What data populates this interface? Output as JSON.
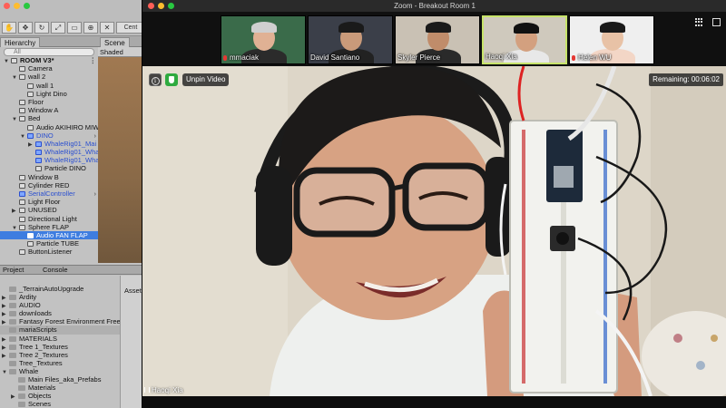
{
  "unity": {
    "toolbar": {
      "center_label": "Cent"
    },
    "tabs": {
      "hierarchy": "Hierarchy",
      "scene": "Scene"
    },
    "search_placeholder": "All",
    "scene_mode": "Shaded",
    "hierarchy": [
      {
        "label": "ROOM V3*",
        "depth": 0,
        "arrow": "▼",
        "bold": true,
        "more": "⋮"
      },
      {
        "label": "Camera",
        "depth": 1,
        "arrow": ""
      },
      {
        "label": "wall 2",
        "depth": 1,
        "arrow": "▼"
      },
      {
        "label": "wall 1",
        "depth": 2,
        "arrow": ""
      },
      {
        "label": "Light Dino",
        "depth": 2,
        "arrow": ""
      },
      {
        "label": "Floor",
        "depth": 1,
        "arrow": ""
      },
      {
        "label": "Window A",
        "depth": 1,
        "arrow": ""
      },
      {
        "label": "Bed",
        "depth": 1,
        "arrow": "▼"
      },
      {
        "label": "Audio AKIHIRO MIW",
        "depth": 2,
        "arrow": ""
      },
      {
        "label": "DINO",
        "depth": 2,
        "arrow": "▼",
        "prefab": true,
        "more": "›"
      },
      {
        "label": "WhaleRig01_Mai",
        "depth": 3,
        "arrow": "▶",
        "prefab": true
      },
      {
        "label": "WhaleRig01_Wha",
        "depth": 3,
        "arrow": "",
        "prefab": true
      },
      {
        "label": "WhaleRig01_Wha",
        "depth": 3,
        "arrow": "",
        "prefab": true
      },
      {
        "label": "Particle DINO",
        "depth": 3,
        "arrow": ""
      },
      {
        "label": "Window B",
        "depth": 1,
        "arrow": ""
      },
      {
        "label": "Cylinder RED",
        "depth": 1,
        "arrow": ""
      },
      {
        "label": "SerialController",
        "depth": 1,
        "arrow": "",
        "prefab": true,
        "more": "›"
      },
      {
        "label": "Light Floor",
        "depth": 1,
        "arrow": ""
      },
      {
        "label": "UNUSED",
        "depth": 1,
        "arrow": "▶"
      },
      {
        "label": "Directional Light",
        "depth": 1,
        "arrow": ""
      },
      {
        "label": "Sphere FLAP",
        "depth": 1,
        "arrow": "▼"
      },
      {
        "label": "Audio FAN FLAP",
        "depth": 2,
        "arrow": "",
        "selected": true
      },
      {
        "label": "Particle TUBE",
        "depth": 2,
        "arrow": ""
      },
      {
        "label": "ButtonListener",
        "depth": 1,
        "arrow": ""
      }
    ],
    "project_tabs": {
      "project": "Project",
      "console": "Console"
    },
    "assets_label": "Asset",
    "project": [
      {
        "label": "_TerrainAutoUpgrade",
        "arrow": ""
      },
      {
        "label": "Ardity",
        "arrow": "▶"
      },
      {
        "label": "AUDIO",
        "arrow": "▶"
      },
      {
        "label": "downloads",
        "arrow": "▶"
      },
      {
        "label": "Fantasy Forest Environment Free",
        "arrow": "▶"
      },
      {
        "label": "mariaScripts",
        "arrow": "",
        "selected": true
      },
      {
        "label": "MATERIALS",
        "arrow": "▶"
      },
      {
        "label": "Tree 1_Textures",
        "arrow": "▶"
      },
      {
        "label": "Tree 2_Textures",
        "arrow": "▶"
      },
      {
        "label": "Tree_Textures",
        "arrow": ""
      },
      {
        "label": "Whale",
        "arrow": "▼"
      },
      {
        "label": "Main Files_aka_Prefabs",
        "arrow": "",
        "indent": true
      },
      {
        "label": "Materials",
        "arrow": "",
        "indent": true
      },
      {
        "label": "Objects",
        "arrow": "▶",
        "indent": true
      },
      {
        "label": "Scenes",
        "arrow": "",
        "indent": true
      }
    ]
  },
  "zoom": {
    "window_title": "Zoom - Breakout Room 1",
    "participants": [
      {
        "name": "mmaciak",
        "muted": true,
        "bg": "#3a6b4a",
        "skin": "#e0b194",
        "hair": "#cfcfcf",
        "shirt": "#2b2b2b"
      },
      {
        "name": "David Santiano",
        "muted": false,
        "bg": "#3b3f49",
        "skin": "#c99a7a",
        "hair": "#1a1a1a",
        "shirt": "#222"
      },
      {
        "name": "Skyler Pierce",
        "muted": false,
        "bg": "#c9c1b4",
        "skin": "#c08c6a",
        "hair": "#1a1a1a",
        "shirt": "#2a2a2a"
      },
      {
        "name": "Haoqi Xia",
        "muted": false,
        "active": true,
        "bg": "#cfc9bd",
        "skin": "#d3a07f",
        "hair": "#111",
        "shirt": "#e8e8e8"
      },
      {
        "name": "Helen WU",
        "muted": true,
        "bg": "#efefef",
        "skin": "#e8c2a6",
        "hair": "#1a1a1a",
        "shirt": "#f3d6c6"
      }
    ],
    "info_icon": "i",
    "unpin_label": "Unpin Video",
    "remaining_label": "Remaining: 00:06:02",
    "speaker_name": "Haoqi Xia"
  }
}
